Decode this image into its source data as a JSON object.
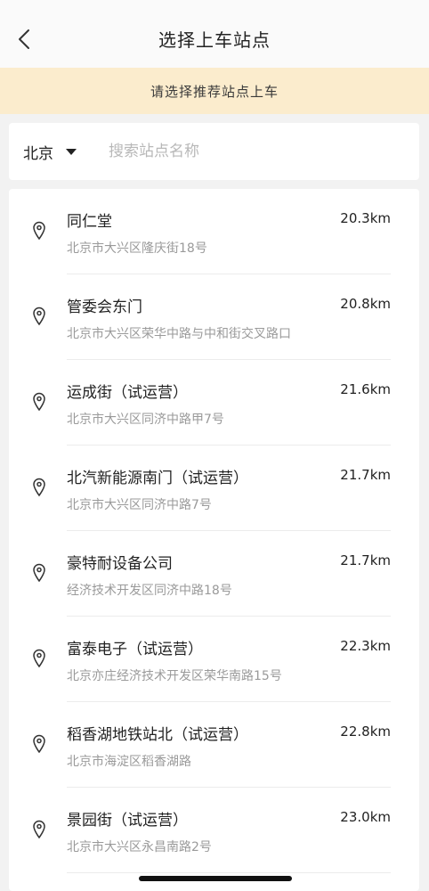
{
  "header": {
    "title": "选择上车站点"
  },
  "notice": "请选择推荐站点上车",
  "search": {
    "city": "北京",
    "placeholder": "搜索站点名称"
  },
  "stations": [
    {
      "name": "同仁堂",
      "address": "北京市大兴区隆庆街18号",
      "distance": "20.3km"
    },
    {
      "name": "管委会东门",
      "address": "北京市大兴区荣华中路与中和街交叉路口",
      "distance": "20.8km"
    },
    {
      "name": "运成街（试运营）",
      "address": "北京市大兴区同济中路甲7号",
      "distance": "21.6km"
    },
    {
      "name": "北汽新能源南门（试运营）",
      "address": "北京市大兴区同济中路7号",
      "distance": "21.7km"
    },
    {
      "name": "豪特耐设备公司",
      "address": "经济技术开发区同济中路18号",
      "distance": "21.7km"
    },
    {
      "name": "富泰电子（试运营）",
      "address": "北京亦庄经济技术开发区荣华南路15号",
      "distance": "22.3km"
    },
    {
      "name": "稻香湖地铁站北（试运营）",
      "address": "北京市海淀区稻香湖路",
      "distance": "22.8km"
    },
    {
      "name": "景园街（试运营）",
      "address": "北京市大兴区永昌南路2号",
      "distance": "23.0km"
    }
  ]
}
